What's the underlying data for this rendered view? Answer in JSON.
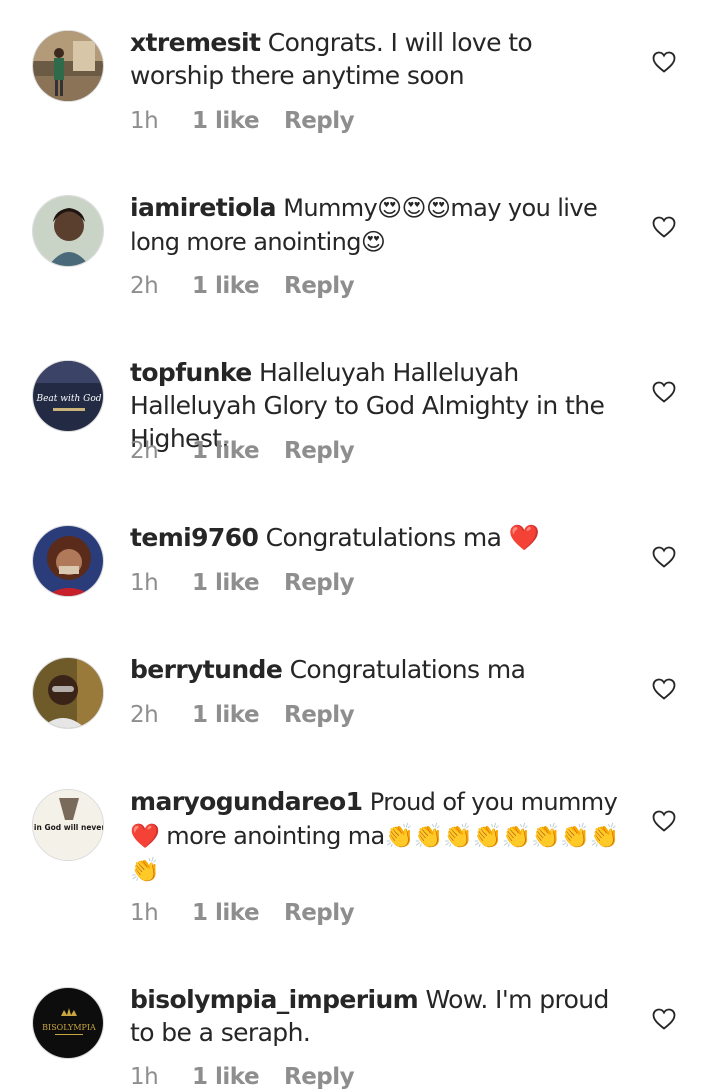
{
  "comments": [
    {
      "username": "xtremesit",
      "text": "Congrats. I will love to worship there anytime soon",
      "time": "1h",
      "likes": "1 like",
      "reply": "Reply"
    },
    {
      "username": "iamiretiola",
      "text": "Mummy😍😍😍may you live long more anointing😍",
      "time": "2h",
      "likes": "1 like",
      "reply": "Reply"
    },
    {
      "username": "topfunke",
      "text": "Halleluyah Halleluyah Halleluyah Glory to God Almighty in the Highest.",
      "time": "2h",
      "likes": "1 like",
      "reply": "Reply"
    },
    {
      "username": "temi9760",
      "text": "Congratulations ma ❤️",
      "time": "1h",
      "likes": "1 like",
      "reply": "Reply"
    },
    {
      "username": "berrytunde",
      "text": "Congratulations ma",
      "time": "2h",
      "likes": "1 like",
      "reply": "Reply"
    },
    {
      "username": "maryogundareo1",
      "text": "Proud of you mummy ❤️ more anointing ma👏👏👏👏👏👏👏👏👏",
      "time": "1h",
      "likes": "1 like",
      "reply": "Reply"
    },
    {
      "username": "bisolympia_imperium",
      "text": "Wow. I'm proud to be a seraph.",
      "time": "1h",
      "likes": "1 like",
      "reply": "Reply"
    }
  ],
  "avatar_texts": {
    "topfunke": "Beat with God",
    "maryogundareo1": "Those who trust in God will never be dissapointed",
    "bisolympia": "BISOLYMPIA"
  },
  "icons": {
    "like": "heart-outline-icon"
  },
  "colors": {
    "text": "#262626",
    "secondary": "#8e8e8e",
    "heart": "#262626"
  }
}
